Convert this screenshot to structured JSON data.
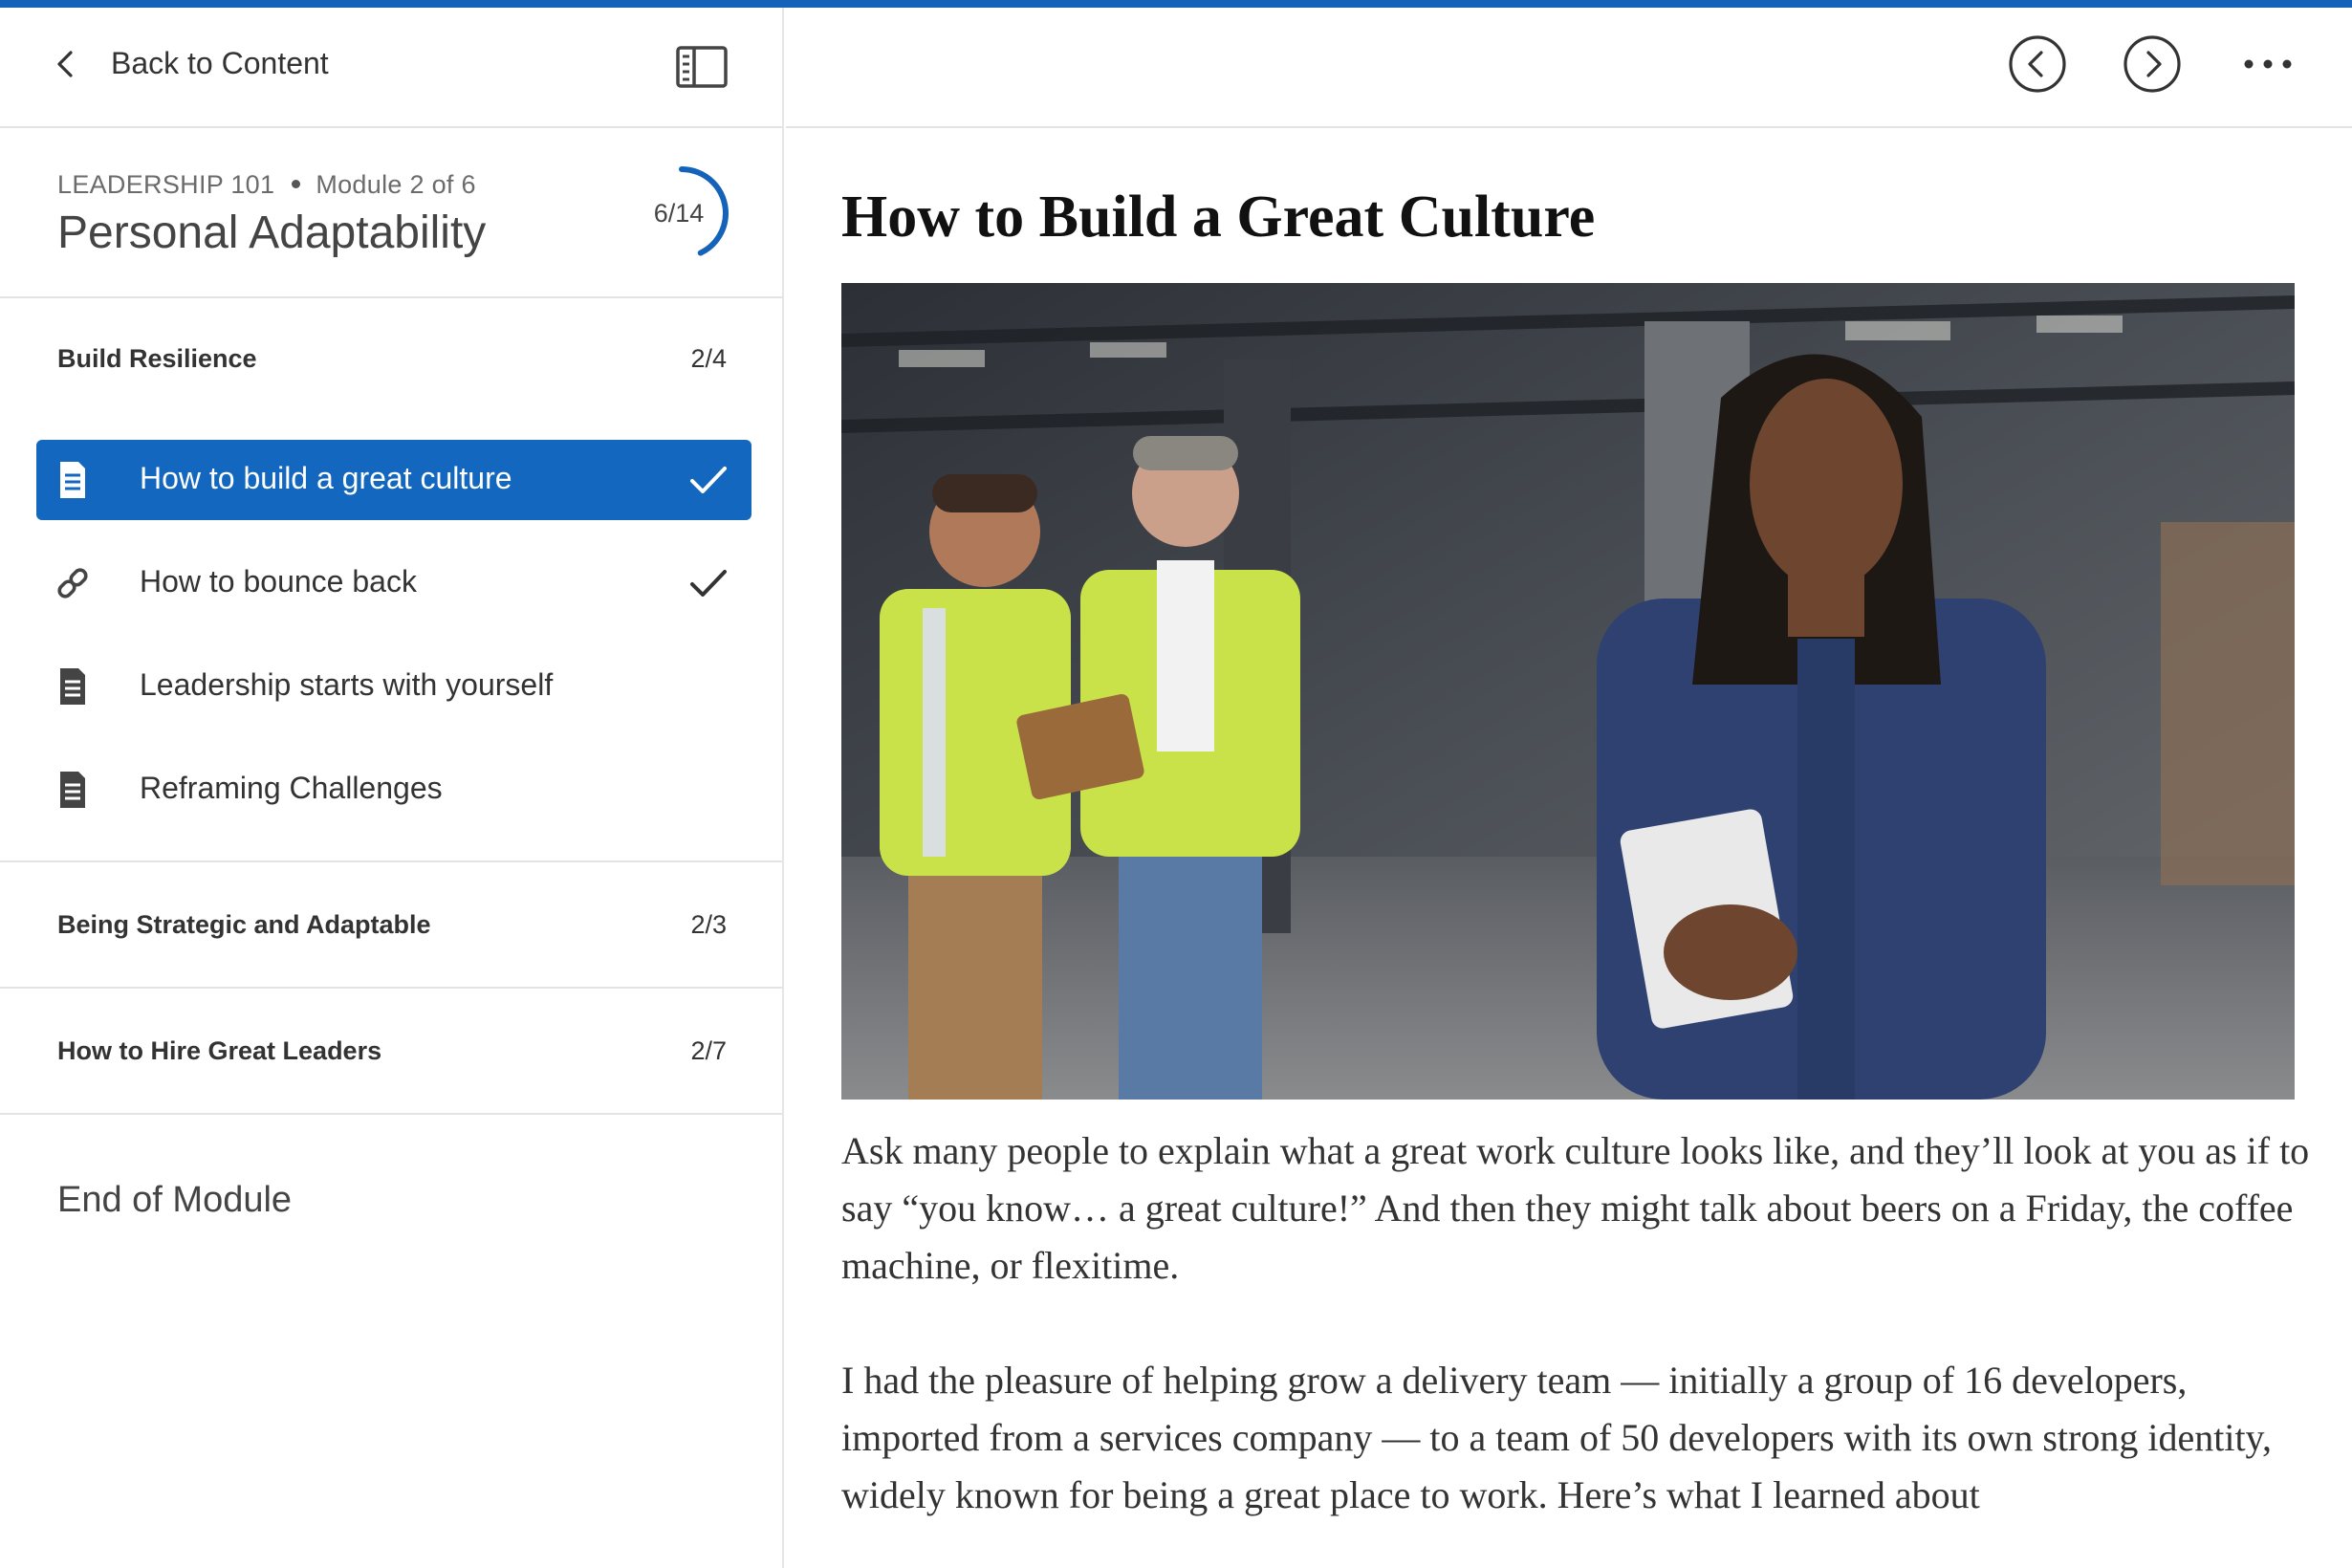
{
  "sidebar": {
    "back_label": "Back to Content",
    "course": "LEADERSHIP 101",
    "module_position": "Module 2 of 6",
    "module_title": "Personal Adaptability",
    "progress_text": "6/14",
    "progress_fraction": 0.4286,
    "sections": [
      {
        "title": "Build Resilience",
        "count": "2/4",
        "lessons": [
          {
            "label": "How to build a great culture",
            "icon": "document-icon",
            "completed": true,
            "active": true
          },
          {
            "label": "How to bounce back",
            "icon": "link-icon",
            "completed": true,
            "active": false
          },
          {
            "label": "Leadership starts with yourself",
            "icon": "document-icon",
            "completed": false,
            "active": false
          },
          {
            "label": "Reframing Challenges",
            "icon": "document-icon",
            "completed": false,
            "active": false
          }
        ]
      },
      {
        "title": "Being Strategic and Adaptable",
        "count": "2/3"
      },
      {
        "title": "How to Hire Great Leaders",
        "count": "2/7"
      }
    ],
    "end_label": "End of Module"
  },
  "header": {
    "prev_icon": "chevron-left-circle-icon",
    "next_icon": "chevron-right-circle-icon",
    "more_icon": "more-horizontal-icon"
  },
  "article": {
    "title": "How to Build a Great Culture",
    "paragraphs": [
      "Ask many people to explain what a great work culture looks like, and they’ll look at you as if to say “you know… a great culture!” And then they might talk about beers on a Friday, the coffee machine, or flexitime.",
      "I had the pleasure of helping grow a delivery team — initially a group of 16 developers, imported from a services company — to a team of 50 developers with its own strong identity, widely known for being a great place to work. Here’s what I learned about"
    ]
  },
  "colors": {
    "accent": "#1463b8",
    "active_row": "#1367bf",
    "divider": "#e3e3e3"
  }
}
